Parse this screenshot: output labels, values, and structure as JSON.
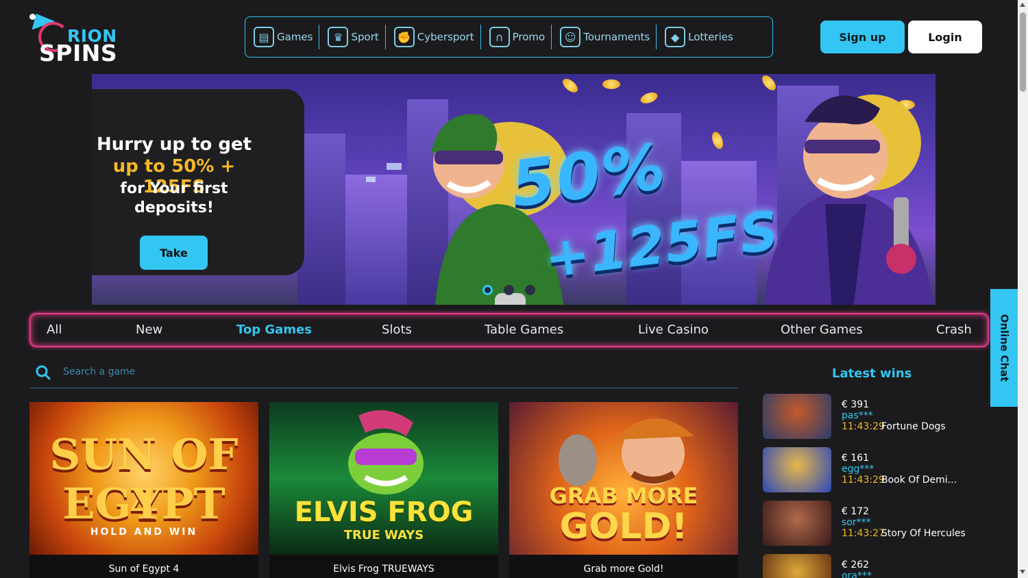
{
  "brand": {
    "logo_line1": "RION",
    "logo_line2": "SPINS"
  },
  "nav": {
    "items": [
      {
        "label": "Games",
        "icon": "slot-machine-icon"
      },
      {
        "label": "Sport",
        "icon": "trophy-icon"
      },
      {
        "label": "Cybersport",
        "icon": "gamepad-hand-icon"
      },
      {
        "label": "Promo",
        "icon": "horseshoe-icon"
      },
      {
        "label": "Tournaments",
        "icon": "mascot-icon"
      },
      {
        "label": "Lotteries",
        "icon": "diamond-icon"
      }
    ]
  },
  "auth": {
    "signup_label": "Sign up",
    "login_label": "Login"
  },
  "banner": {
    "line1": "Hurry up to get",
    "line2": "up to 50% + 125FS",
    "line3": "for Your first",
    "line4": "deposits!",
    "cta_label": "Take",
    "headline_top": "50%",
    "headline_bottom": "+125FS",
    "slides": 3,
    "active_slide": 1
  },
  "categories": {
    "tabs": [
      "All",
      "New",
      "Top Games",
      "Slots",
      "Table Games",
      "Live Casino",
      "Other Games",
      "Crash"
    ],
    "active": "Top Games"
  },
  "search": {
    "placeholder": "Search a game"
  },
  "games": [
    {
      "name": "Sun of Egypt 4",
      "art_title_1": "SUN OF 4",
      "art_title_2": "EGYPT",
      "art_sub": "HOLD AND WIN"
    },
    {
      "name": "Elvis Frog TRUEWAYS",
      "art_title_1": "ELVIS FROG",
      "art_sub": "TRUE WAYS"
    },
    {
      "name": "Grab more Gold!",
      "art_title_1": "GRAB MORE",
      "art_title_2": "GOLD!"
    }
  ],
  "latest_wins": {
    "title": "Latest wins",
    "rows": [
      {
        "amount": "€ 391",
        "user": "pas***",
        "time": "11:43:29",
        "game": "Fortune Dogs"
      },
      {
        "amount": "€ 161",
        "user": "egg***",
        "time": "11:43:29",
        "game": "Book Of Demi..."
      },
      {
        "amount": "€ 172",
        "user": "sor***",
        "time": "11:43:27",
        "game": "Story Of Hercules"
      },
      {
        "amount": "€ 262",
        "user": "ora***",
        "time": "",
        "game": ""
      }
    ]
  },
  "chat": {
    "label": "Online Chat"
  },
  "colors": {
    "accent": "#34c6f2",
    "gold": "#f5b826",
    "pink": "#e03b86",
    "bg": "#1b1b1d"
  }
}
